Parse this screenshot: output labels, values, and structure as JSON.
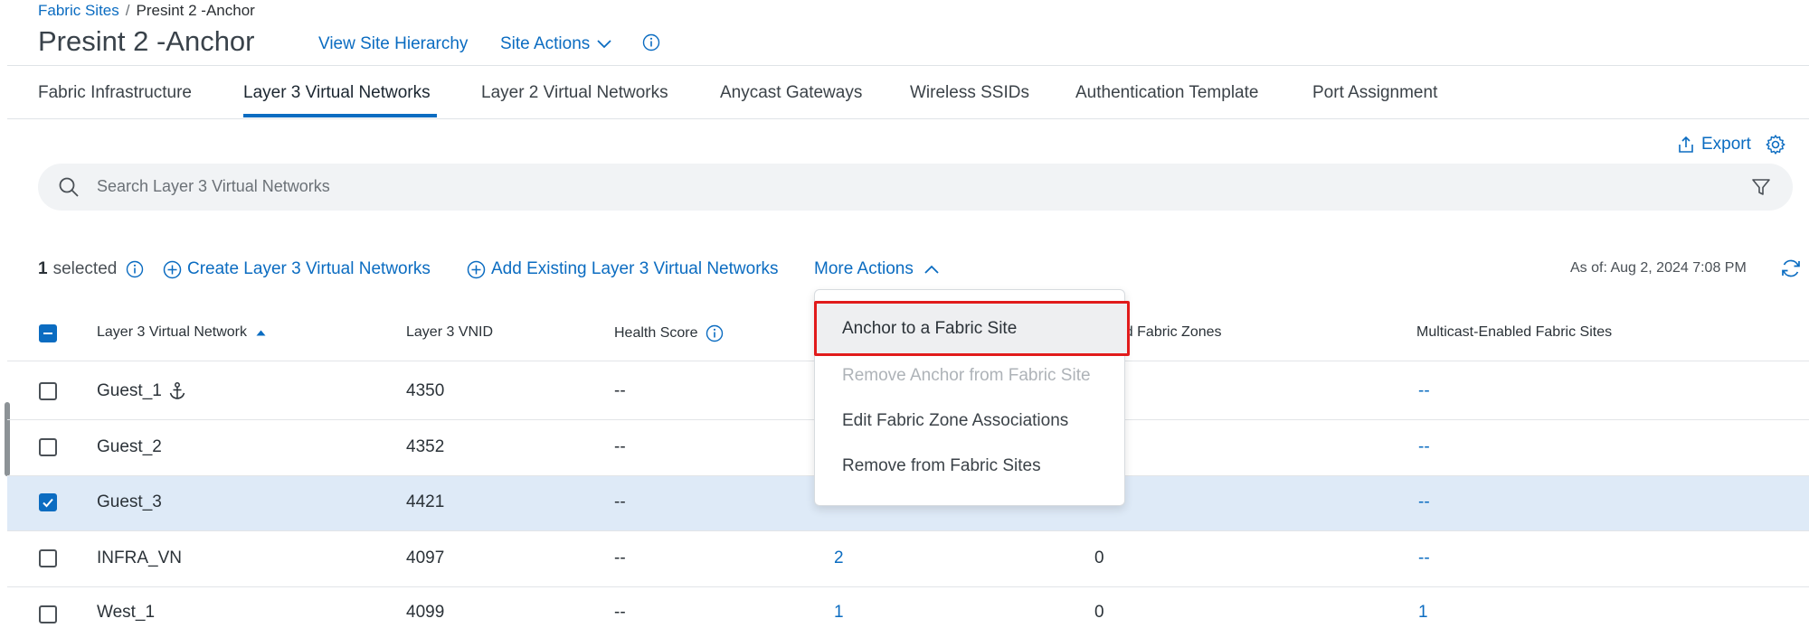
{
  "breadcrumb": {
    "parent": "Fabric Sites",
    "separator": "/",
    "current": "Presint 2 -Anchor"
  },
  "page_title": "Presint 2 -Anchor",
  "header_links": {
    "view_hierarchy": "View Site Hierarchy",
    "site_actions": "Site Actions"
  },
  "tabs": [
    {
      "label": "Fabric Infrastructure"
    },
    {
      "label": "Layer 3 Virtual Networks"
    },
    {
      "label": "Layer 2 Virtual Networks"
    },
    {
      "label": "Anycast Gateways"
    },
    {
      "label": "Wireless SSIDs"
    },
    {
      "label": "Authentication Template"
    },
    {
      "label": "Port Assignment"
    }
  ],
  "active_tab": "Layer 3 Virtual Networks",
  "export_label": "Export",
  "search": {
    "placeholder": "Search Layer 3 Virtual Networks"
  },
  "toolbar": {
    "selected_count": "1",
    "selected_label": "selected",
    "create_label": "Create Layer 3 Virtual Networks",
    "add_existing_label": "Add Existing Layer 3 Virtual Networks",
    "more_actions_label": "More Actions",
    "as_of": "As of: Aug 2, 2024 7:08 PM"
  },
  "table": {
    "columns": [
      "Layer 3 Virtual Network",
      "Layer 3 VNID",
      "Health Score",
      "ciated Fabric Zones",
      "Multicast-Enabled Fabric Sites"
    ],
    "rows": [
      {
        "name": "Guest_1",
        "vnid": "4350",
        "health": "--",
        "sites": "",
        "zones": "",
        "multicast": "--",
        "anchor": true,
        "selected": false
      },
      {
        "name": "Guest_2",
        "vnid": "4352",
        "health": "--",
        "sites": "",
        "zones": "",
        "multicast": "--",
        "anchor": false,
        "selected": false
      },
      {
        "name": "Guest_3",
        "vnid": "4421",
        "health": "--",
        "sites": "",
        "zones": "",
        "multicast": "--",
        "anchor": false,
        "selected": true
      },
      {
        "name": "INFRA_VN",
        "vnid": "4097",
        "health": "--",
        "sites": "2",
        "zones": "0",
        "multicast": "--",
        "anchor": false,
        "selected": false
      },
      {
        "name": "West_1",
        "vnid": "4099",
        "health": "--",
        "sites": "1",
        "zones": "0",
        "multicast": "1",
        "anchor": false,
        "selected": false
      }
    ]
  },
  "more_actions_menu": {
    "items": [
      {
        "label": "Anchor to a Fabric Site",
        "enabled": true,
        "highlighted": true
      },
      {
        "label": "Remove Anchor from Fabric Site",
        "enabled": false
      },
      {
        "label": "Edit Fabric Zone Associations",
        "enabled": true
      },
      {
        "label": "Remove from Fabric Sites",
        "enabled": true
      }
    ]
  },
  "colors": {
    "accent": "#0b6cc1",
    "highlight_border": "#e11b1b",
    "selected_row": "#deeaf7",
    "disabled_text": "#aeb3b8"
  }
}
